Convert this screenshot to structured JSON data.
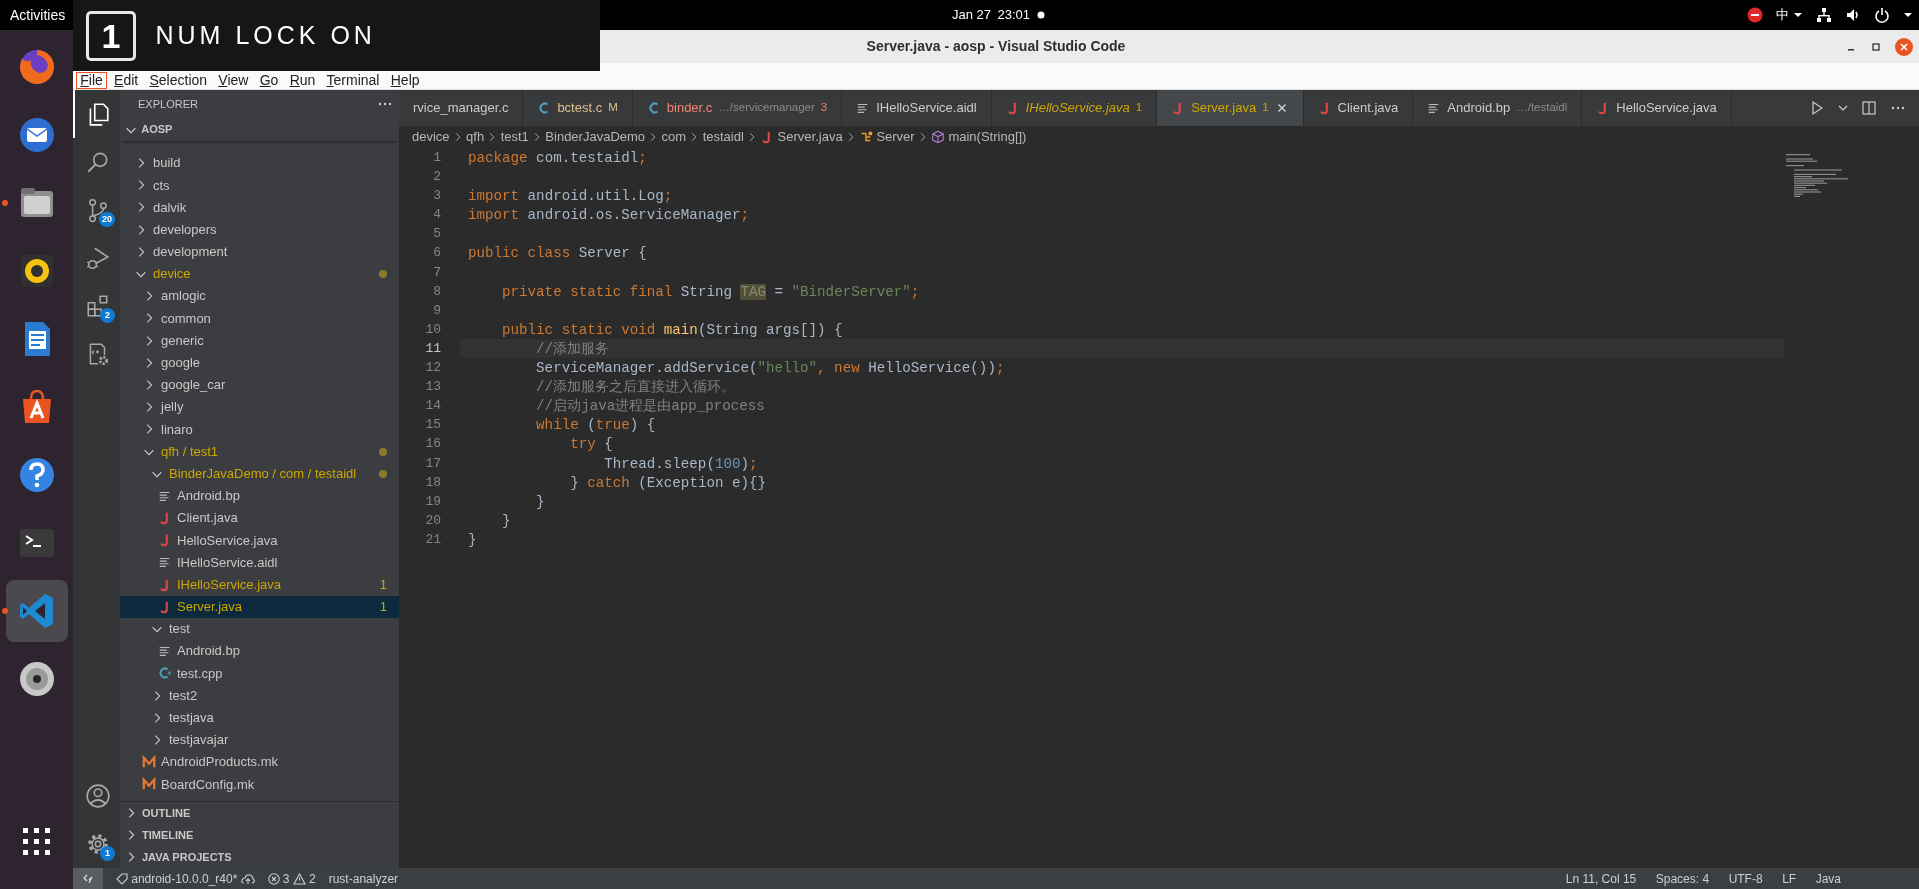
{
  "topbar": {
    "activities": "Activities",
    "date": "Jan 27",
    "time": "23:01",
    "input_method": "中"
  },
  "osd": {
    "key": "1",
    "text": "NUM LOCK ON"
  },
  "dock": {
    "items": [
      {
        "kind": "browser",
        "running": false,
        "selected": false
      },
      {
        "kind": "mail",
        "running": false,
        "selected": false
      },
      {
        "kind": "files",
        "running": true,
        "selected": false
      },
      {
        "kind": "music",
        "running": false,
        "selected": false
      },
      {
        "kind": "writer",
        "running": false,
        "selected": false
      },
      {
        "kind": "store",
        "running": false,
        "selected": false
      },
      {
        "kind": "help",
        "running": false,
        "selected": false
      },
      {
        "kind": "terminal",
        "running": false,
        "selected": false
      },
      {
        "kind": "vscode",
        "running": true,
        "selected": true
      },
      {
        "kind": "disc",
        "running": false,
        "selected": false
      }
    ]
  },
  "window": {
    "title": "Server.java - aosp - Visual Studio Code"
  },
  "menu": [
    {
      "label": "File",
      "selected": true
    },
    {
      "label": "Edit",
      "selected": false
    },
    {
      "label": "Selection",
      "selected": false
    },
    {
      "label": "View",
      "selected": false
    },
    {
      "label": "Go",
      "selected": false
    },
    {
      "label": "Run",
      "selected": false
    },
    {
      "label": "Terminal",
      "selected": false
    },
    {
      "label": "Help",
      "selected": false
    }
  ],
  "activity_bar": {
    "items": [
      {
        "kind": "explorer",
        "selected": true
      },
      {
        "kind": "search",
        "selected": false
      },
      {
        "kind": "source_control",
        "badge": "20",
        "selected": false
      },
      {
        "kind": "run",
        "selected": false
      },
      {
        "kind": "extensions",
        "badge": "2",
        "selected": false
      },
      {
        "kind": "cpp_config",
        "selected": false
      }
    ],
    "bottom": [
      {
        "kind": "account"
      },
      {
        "kind": "settings",
        "badge": "1"
      }
    ]
  },
  "sidebar": {
    "title": "EXPLORER",
    "root": "AOSP",
    "tree": [
      {
        "label": "build",
        "kind": "folder",
        "expanded": false,
        "warning": false,
        "selected": false
      },
      {
        "label": "cts",
        "kind": "folder",
        "expanded": false,
        "warning": false,
        "selected": false
      },
      {
        "label": "dalvik",
        "kind": "folder",
        "expanded": false,
        "warning": false,
        "selected": false
      },
      {
        "label": "developers",
        "kind": "folder",
        "expanded": false,
        "warning": false,
        "selected": false
      },
      {
        "label": "development",
        "kind": "folder",
        "expanded": false,
        "warning": false,
        "selected": false
      },
      {
        "label": "device",
        "kind": "folder",
        "expanded": true,
        "warning": true,
        "selected": false,
        "children": [
          {
            "label": "amlogic",
            "kind": "folder",
            "expanded": false,
            "warning": false,
            "selected": false
          },
          {
            "label": "common",
            "kind": "folder",
            "expanded": false,
            "warning": false,
            "selected": false
          },
          {
            "label": "generic",
            "kind": "folder",
            "expanded": false,
            "warning": false,
            "selected": false
          },
          {
            "label": "google",
            "kind": "folder",
            "expanded": false,
            "warning": false,
            "selected": false
          },
          {
            "label": "google_car",
            "kind": "folder",
            "expanded": false,
            "warning": false,
            "selected": false
          },
          {
            "label": "jelly",
            "kind": "folder",
            "expanded": false,
            "warning": false,
            "selected": false
          },
          {
            "label": "linaro",
            "kind": "folder",
            "expanded": false,
            "warning": false,
            "selected": false
          },
          {
            "label": "qfh / test1",
            "kind": "folder",
            "expanded": true,
            "warning": true,
            "selected": false,
            "children": [
              {
                "label": "BinderJavaDemo / com / testaidl",
                "kind": "folder",
                "expanded": true,
                "warning": true,
                "selected": false,
                "children": [
                  {
                    "label": "Android.bp",
                    "kind": "text",
                    "warning": false,
                    "selected": false
                  },
                  {
                    "label": "Client.java",
                    "kind": "java",
                    "warning": false,
                    "selected": false
                  },
                  {
                    "label": "HelloService.java",
                    "kind": "java",
                    "warning": false,
                    "selected": false
                  },
                  {
                    "label": "IHelloService.aidl",
                    "kind": "text",
                    "warning": false,
                    "selected": false
                  },
                  {
                    "label": "IHelloService.java",
                    "kind": "java",
                    "warning": true,
                    "problems": "1",
                    "selected": false
                  },
                  {
                    "label": "Server.java",
                    "kind": "java",
                    "warning": true,
                    "problems": "1",
                    "selected": true
                  }
                ]
              },
              {
                "label": "test",
                "kind": "folder",
                "expanded": true,
                "warning": false,
                "selected": false,
                "children": [
                  {
                    "label": "Android.bp",
                    "kind": "text",
                    "warning": false,
                    "selected": false
                  },
                  {
                    "label": "test.cpp",
                    "kind": "cpp",
                    "warning": false,
                    "selected": false
                  }
                ]
              },
              {
                "label": "test2",
                "kind": "folder",
                "expanded": false,
                "warning": false,
                "selected": false
              },
              {
                "label": "testjava",
                "kind": "folder",
                "expanded": false,
                "warning": false,
                "selected": false
              },
              {
                "label": "testjavajar",
                "kind": "folder",
                "expanded": false,
                "warning": false,
                "selected": false
              }
            ]
          },
          {
            "label": "AndroidProducts.mk",
            "kind": "make",
            "warning": false,
            "selected": false
          },
          {
            "label": "BoardConfig.mk",
            "kind": "make",
            "warning": false,
            "selected": false
          }
        ]
      }
    ],
    "sections": [
      {
        "label": "OUTLINE",
        "expanded": false
      },
      {
        "label": "TIMELINE",
        "expanded": false
      },
      {
        "label": "JAVA PROJECTS",
        "expanded": false
      }
    ]
  },
  "tabs": [
    {
      "label": "rvice_manager.c",
      "kind": "none",
      "color": "#cccccc",
      "preview": false,
      "selected": false
    },
    {
      "label": "bctest.c",
      "kind": "c",
      "color": "#e2c08d",
      "badge": "M",
      "preview": false,
      "selected": false
    },
    {
      "label": "binder.c",
      "kind": "c",
      "color": "#f48771",
      "description": "…/servicemanager",
      "badge": "3",
      "preview": false,
      "selected": false
    },
    {
      "label": "IHelloService.aidl",
      "kind": "text",
      "color": "#cccccc",
      "preview": false,
      "selected": false
    },
    {
      "label": "IHelloService.java",
      "kind": "java",
      "color": "#cca700",
      "badge": "1",
      "preview": true,
      "selected": false
    },
    {
      "label": "Server.java",
      "kind": "java",
      "color": "#cca700",
      "badge": "1",
      "preview": false,
      "selected": true
    },
    {
      "label": "Client.java",
      "kind": "java",
      "color": "#cccccc",
      "preview": false,
      "selected": false
    },
    {
      "label": "Android.bp",
      "kind": "text",
      "color": "#cccccc",
      "description": "…/testaidl",
      "preview": false,
      "selected": false
    },
    {
      "label": "HelloService.java",
      "kind": "java",
      "color": "#cccccc",
      "preview": false,
      "selected": false
    }
  ],
  "breadcrumbs": [
    {
      "label": "device",
      "kind": "folder"
    },
    {
      "label": "qfh",
      "kind": "folder"
    },
    {
      "label": "test1",
      "kind": "folder"
    },
    {
      "label": "BinderJavaDemo",
      "kind": "folder"
    },
    {
      "label": "com",
      "kind": "folder"
    },
    {
      "label": "testaidl",
      "kind": "folder"
    },
    {
      "label": "Server.java",
      "kind": "java"
    },
    {
      "label": "Server",
      "kind": "class"
    },
    {
      "label": "main(String[])",
      "kind": "method"
    }
  ],
  "editor": {
    "lines": [
      {
        "number": "1",
        "current": false,
        "tokens": [
          {
            "text": "package",
            "kind": "kw"
          },
          {
            "text": " com.testaidl",
            "kind": "plain"
          },
          {
            "text": ";",
            "kind": "kw"
          }
        ]
      },
      {
        "number": "2",
        "current": false
      },
      {
        "number": "3",
        "current": false,
        "tokens": [
          {
            "text": "import",
            "kind": "kw"
          },
          {
            "text": " android.util.Log",
            "kind": "plain"
          },
          {
            "text": ";",
            "kind": "kw"
          }
        ]
      },
      {
        "number": "4",
        "current": false,
        "tokens": [
          {
            "text": "import",
            "kind": "kw"
          },
          {
            "text": " android.os.ServiceManager",
            "kind": "plain"
          },
          {
            "text": ";",
            "kind": "kw"
          }
        ]
      },
      {
        "number": "5",
        "current": false
      },
      {
        "number": "6",
        "current": false,
        "tokens": [
          {
            "text": "public class",
            "kind": "kw"
          },
          {
            "text": " Server {",
            "kind": "plain"
          }
        ]
      },
      {
        "number": "7",
        "current": false
      },
      {
        "number": "8",
        "current": false,
        "tokens": [
          {
            "text": "    private static final",
            "kind": "kw"
          },
          {
            "text": " String ",
            "kind": "plain"
          },
          {
            "text": "TAG",
            "kind": "match"
          },
          {
            "text": " = ",
            "kind": "plain"
          },
          {
            "text": "\"BinderServer\"",
            "kind": "str"
          },
          {
            "text": ";",
            "kind": "kw"
          }
        ]
      },
      {
        "number": "9",
        "current": false
      },
      {
        "number": "10",
        "current": false,
        "tokens": [
          {
            "text": "    public static void",
            "kind": "kw"
          },
          {
            "text": " main",
            "kind": "fn"
          },
          {
            "text": "(String args[]) {",
            "kind": "plain"
          }
        ]
      },
      {
        "number": "11",
        "current": true,
        "tokens": [
          {
            "text": "        //添加服务",
            "kind": "com"
          }
        ]
      },
      {
        "number": "12",
        "current": false,
        "tokens": [
          {
            "text": "        ServiceManager.addService(",
            "kind": "plain"
          },
          {
            "text": "\"hello\"",
            "kind": "str"
          },
          {
            "text": ", new",
            "kind": "kw"
          },
          {
            "text": " HelloService())",
            "kind": "plain"
          },
          {
            "text": ";",
            "kind": "kw"
          }
        ]
      },
      {
        "number": "13",
        "current": false,
        "tokens": [
          {
            "text": "        //添加服务之后直接进入循环。",
            "kind": "com"
          }
        ]
      },
      {
        "number": "14",
        "current": false,
        "tokens": [
          {
            "text": "        //启动java进程是由app_process",
            "kind": "com"
          }
        ]
      },
      {
        "number": "15",
        "current": false,
        "tokens": [
          {
            "text": "        while",
            "kind": "kw"
          },
          {
            "text": " (",
            "kind": "plain"
          },
          {
            "text": "true",
            "kind": "kw"
          },
          {
            "text": ") {",
            "kind": "plain"
          }
        ]
      },
      {
        "number": "16",
        "current": false,
        "tokens": [
          {
            "text": "            try",
            "kind": "kw"
          },
          {
            "text": " {",
            "kind": "plain"
          }
        ]
      },
      {
        "number": "17",
        "current": false,
        "tokens": [
          {
            "text": "                Thread.sleep(",
            "kind": "plain"
          },
          {
            "text": "100",
            "kind": "num"
          },
          {
            "text": ")",
            "kind": "plain"
          },
          {
            "text": ";",
            "kind": "kw"
          }
        ]
      },
      {
        "number": "18",
        "current": false,
        "tokens": [
          {
            "text": "            } ",
            "kind": "plain"
          },
          {
            "text": "catch",
            "kind": "kw"
          },
          {
            "text": " (Exception e){}",
            "kind": "plain"
          }
        ]
      },
      {
        "number": "19",
        "current": false,
        "tokens": [
          {
            "text": "        }",
            "kind": "plain"
          }
        ]
      },
      {
        "number": "20",
        "current": false,
        "tokens": [
          {
            "text": "    }",
            "kind": "plain"
          }
        ]
      },
      {
        "number": "21",
        "current": false,
        "tokens": [
          {
            "text": "}",
            "kind": "plain"
          }
        ]
      }
    ]
  },
  "status_bar": {
    "branch": "android-10.0.0_r40*",
    "errors": "3",
    "warnings": "2",
    "language_server": "rust-analyzer",
    "position": "Ln 11, Col 15",
    "indentation": "Spaces: 4",
    "encoding": "UTF-8",
    "line_ending": "LF",
    "language": "Java"
  }
}
